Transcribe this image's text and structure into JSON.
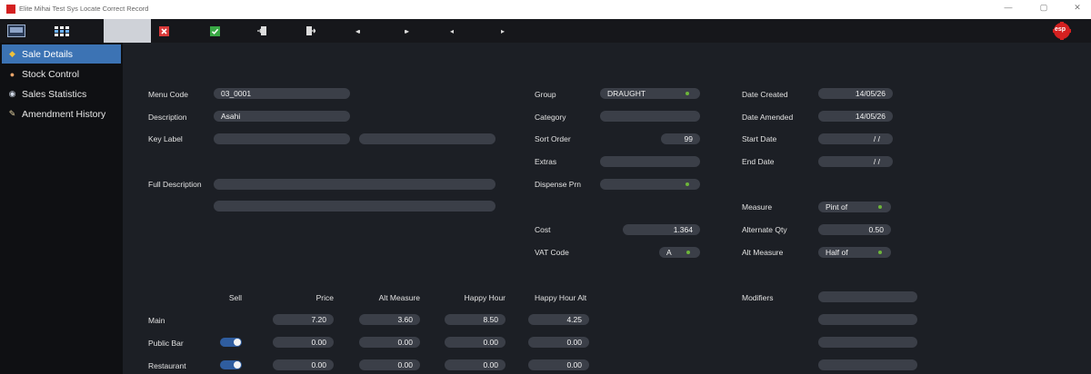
{
  "window": {
    "title": "Elite Mihai Test Sys Locate Correct Record",
    "minimize_glyph": "—",
    "restore_glyph": "▢",
    "close_glyph": "✕"
  },
  "toolbar": {
    "logo_text": "esp",
    "buttons": [
      {
        "name": "keyboard-icon"
      },
      {
        "name": "grid-icon"
      },
      {
        "name": "blank-tab"
      },
      {
        "name": "cancel-icon",
        "color": "#d93a3a"
      },
      {
        "name": "confirm-icon",
        "color": "#39a845"
      },
      {
        "name": "import-icon"
      },
      {
        "name": "export-icon"
      },
      {
        "name": "first-record-icon",
        "glyph": "◂◂"
      },
      {
        "name": "last-record-icon",
        "glyph": "▸▸"
      },
      {
        "name": "previous-record-icon",
        "glyph": "◂"
      },
      {
        "name": "next-record-icon",
        "glyph": "▸"
      }
    ]
  },
  "sidebar": {
    "items": [
      {
        "label": "Sale Details",
        "icon": "mug-icon",
        "active": true
      },
      {
        "label": "Stock Control",
        "icon": "box-icon",
        "active": false
      },
      {
        "label": "Sales Statistics",
        "icon": "eye-icon",
        "active": false
      },
      {
        "label": "Amendment History",
        "icon": "pencil-icon",
        "active": false
      }
    ]
  },
  "form": {
    "menu_code_label": "Menu Code",
    "menu_code": "03_0001",
    "description_label": "Description",
    "description": "Asahi",
    "key_label_label": "Key Label",
    "key_label_1": "",
    "key_label_2": "",
    "full_description_label": "Full Description",
    "full_description_1": "",
    "full_description_2": "",
    "group_label": "Group",
    "group": "DRAUGHT",
    "category_label": "Category",
    "category": "",
    "sort_order_label": "Sort Order",
    "sort_order": "99",
    "extras_label": "Extras",
    "extras": "",
    "dispense_prn_label": "Dispense Prn",
    "dispense_prn": "",
    "cost_label": "Cost",
    "cost": "1.364",
    "vat_code_label": "VAT Code",
    "vat_code": "A",
    "date_created_label": "Date Created",
    "date_created": "14/05/26",
    "date_amended_label": "Date Amended",
    "date_amended": "14/05/26",
    "start_date_label": "Start Date",
    "start_date": "/ /",
    "end_date_label": "End Date",
    "end_date": "/ /",
    "measure_label": "Measure",
    "measure": "Pint of",
    "alternate_qty_label": "Alternate Qty",
    "alternate_qty": "0.50",
    "alt_measure_label": "Alt Measure",
    "alt_measure": "Half of",
    "modifiers_label": "Modifiers"
  },
  "prices": {
    "headers": [
      "Sell",
      "Price",
      "Alt Measure",
      "Happy Hour",
      "Happy Hour Alt"
    ],
    "rows": [
      {
        "name": "Main",
        "sell": null,
        "price": "7.20",
        "alt_measure": "3.60",
        "happy_hour": "8.50",
        "happy_hour_alt": "4.25"
      },
      {
        "name": "Public Bar",
        "sell": true,
        "price": "0.00",
        "alt_measure": "0.00",
        "happy_hour": "0.00",
        "happy_hour_alt": "0.00"
      },
      {
        "name": "Restaurant",
        "sell": true,
        "price": "0.00",
        "alt_measure": "0.00",
        "happy_hour": "0.00",
        "happy_hour_alt": "0.00"
      }
    ]
  },
  "colors": {
    "accent": "#3c73b4",
    "field_bg": "#3b3f48",
    "toggle_on": "#2f5d9f",
    "dropdown_dot": "#6db53a",
    "brand_red": "#d42020"
  }
}
